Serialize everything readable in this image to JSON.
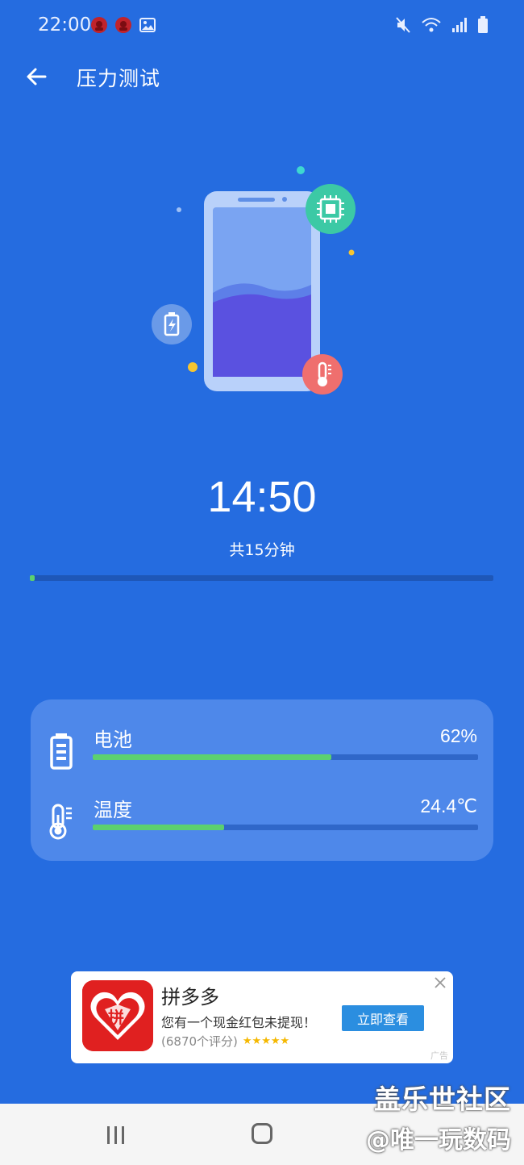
{
  "status_bar": {
    "time": "22:00",
    "left_icons": [
      "app-notification-icon",
      "app-notification-icon",
      "gallery-icon"
    ],
    "right_icons": [
      "mute-icon",
      "wifi-icon",
      "signal-icon",
      "battery-icon"
    ]
  },
  "app_bar": {
    "title": "压力测试",
    "back_icon": "arrow-left-icon"
  },
  "illustration": {
    "icons": [
      "phone-icon",
      "chip-icon",
      "battery-charging-icon",
      "thermometer-icon"
    ]
  },
  "timer": {
    "remaining": "14:50",
    "total_label": "共15分钟",
    "progress_fraction": 0.011
  },
  "stats": [
    {
      "label": "电池",
      "value": "62%",
      "fraction": 0.62,
      "icon": "battery-icon"
    },
    {
      "label": "温度",
      "value": "24.4℃",
      "fraction": 0.34,
      "icon": "thermometer-icon"
    }
  ],
  "ad": {
    "title": "拼多多",
    "description": "您有一个现金红包未提现！",
    "rating": "(6870个评分)",
    "stars": "★★★★★",
    "cta": "立即查看",
    "tag": "广告",
    "logo_text": "拼",
    "close_icon": "close-icon"
  },
  "nav_bar": {
    "icons": [
      "recents-icon",
      "home-icon",
      "back-icon"
    ]
  },
  "watermark": {
    "line1": "盖乐世社区",
    "line2": "@唯一玩数码"
  },
  "colors": {
    "background": "#256ce0",
    "progress_green": "#5cd06f",
    "card": "#4e88ea",
    "ad_button": "#2b8ee0"
  }
}
